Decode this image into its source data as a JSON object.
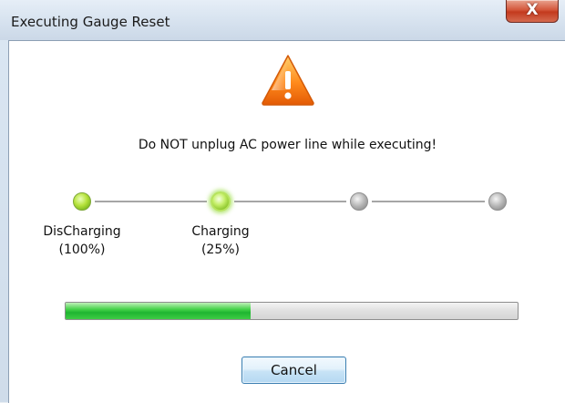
{
  "window": {
    "title": "Executing Gauge Reset",
    "close_glyph": "X"
  },
  "dialog": {
    "warning_icon": "warning-triangle-icon",
    "warning_message": "Do NOT unplug AC power line while executing!",
    "steps": [
      {
        "name": "DisCharging",
        "percent": "(100%)",
        "state": "done"
      },
      {
        "name": "Charging",
        "percent": "(25%)",
        "state": "active"
      },
      {
        "name": "",
        "percent": "",
        "state": "pending"
      },
      {
        "name": "",
        "percent": "",
        "state": "pending"
      }
    ],
    "progress_fraction": 0.41,
    "cancel_label": "Cancel"
  },
  "colors": {
    "progress_green": "#1fb531",
    "step_done_green": "#7cb81c",
    "step_pending_gray": "#8a8a8a",
    "close_red": "#c33a1e"
  }
}
